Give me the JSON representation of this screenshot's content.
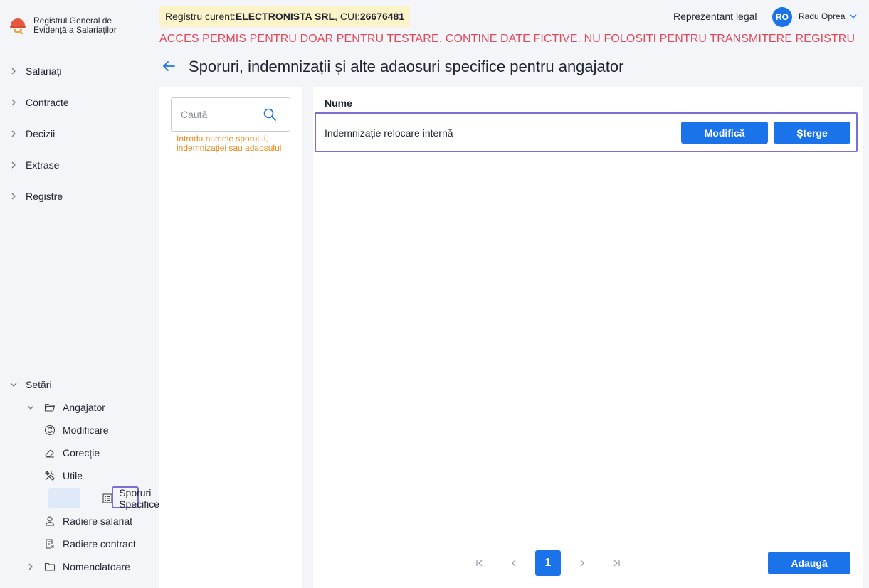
{
  "app": {
    "name_line1": "Registrul General de",
    "name_line2": "Evidență a Salariaților"
  },
  "sidebar": {
    "items": [
      {
        "label": "Salariați"
      },
      {
        "label": "Contracte"
      },
      {
        "label": "Decizii"
      },
      {
        "label": "Extrase"
      },
      {
        "label": "Registre"
      }
    ],
    "settings": {
      "label": "Setări",
      "employer": {
        "label": "Angajator",
        "children": [
          {
            "label": "Modificare"
          },
          {
            "label": "Corecție"
          },
          {
            "label": "Utile"
          },
          {
            "label": "Sporuri Specifice"
          },
          {
            "label": "Radiere salariat"
          },
          {
            "label": "Radiere contract"
          }
        ]
      },
      "nomenclature": {
        "label": "Nomenclatoare"
      }
    }
  },
  "header": {
    "registry_prefix": "Registru curent: ",
    "registry_name": "ELECTRONISTA SRL",
    "cui_prefix": ", CUI: ",
    "cui": "26676481",
    "role": "Reprezentant legal",
    "avatar_initials": "RO",
    "user_name": "Radu Oprea",
    "warning": "ACCES PERMIS PENTRU DOAR PENTRU TESTARE. CONTINE DATE FICTIVE. NU FOLOSITI PENTRU TRANSMITERE REGISTRU"
  },
  "page": {
    "title": "Sporuri, indemnizații și alte adaosuri specifice pentru angajator"
  },
  "filter": {
    "search_placeholder": "Caută",
    "search_value": "",
    "hint": "Introdu numele sporului, indemnizației sau adaosului"
  },
  "table": {
    "column_name": "Nume",
    "rows": [
      {
        "name": "Indemnizație relocare internă"
      }
    ],
    "edit_label": "Modifică",
    "delete_label": "Șterge"
  },
  "pagination": {
    "current_page": "1"
  },
  "actions": {
    "add_label": "Adaugă"
  },
  "colors": {
    "accent": "#1a73e8",
    "warning": "#e0485a",
    "hint": "#ee8a1a",
    "highlight": "#7b6fd6",
    "badge_bg": "#fdf3c8"
  }
}
